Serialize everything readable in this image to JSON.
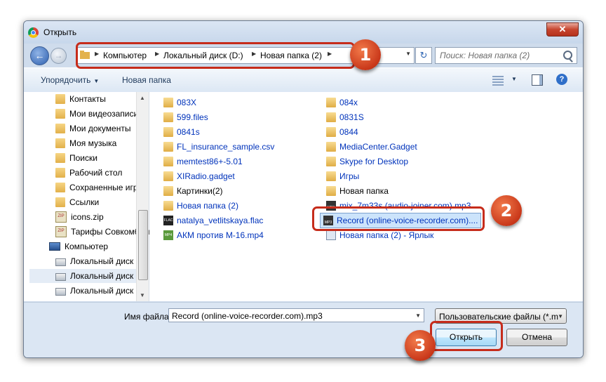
{
  "window": {
    "title": "Открыть",
    "close_label": "✕"
  },
  "navbar": {
    "back_glyph": "←",
    "forward_glyph": "→",
    "breadcrumbs": [
      "Компьютер",
      "Локальный диск (D:)",
      "Новая папка (2)"
    ],
    "refresh_glyph": "↻",
    "search_placeholder": "Поиск: Новая папка (2)"
  },
  "toolbar": {
    "organize_label": "Упорядочить",
    "new_folder_label": "Новая папка",
    "help_label": "?"
  },
  "nav_pane": {
    "items": [
      {
        "label": "Контакты",
        "icon": "folder"
      },
      {
        "label": "Мои видеозаписи",
        "icon": "folder"
      },
      {
        "label": "Мои документы",
        "icon": "folder"
      },
      {
        "label": "Моя музыка",
        "icon": "folder"
      },
      {
        "label": "Поиски",
        "icon": "folder"
      },
      {
        "label": "Рабочий стол",
        "icon": "folder"
      },
      {
        "label": "Сохраненные игры",
        "icon": "folder"
      },
      {
        "label": "Ссылки",
        "icon": "folder"
      },
      {
        "label": "icons.zip",
        "icon": "zip"
      },
      {
        "label": "Тарифы Совкомбанк",
        "icon": "zip"
      },
      {
        "label": "Компьютер",
        "icon": "computer"
      },
      {
        "label": "Локальный диск",
        "icon": "drive"
      },
      {
        "label": "Локальный диск",
        "icon": "drive"
      },
      {
        "label": "Локальный диск",
        "icon": "drive"
      }
    ]
  },
  "files": {
    "left_column": [
      {
        "name": "083X",
        "type": "folder"
      },
      {
        "name": "599.files",
        "type": "folder"
      },
      {
        "name": "0841s",
        "type": "folder"
      },
      {
        "name": "FL_insurance_sample.csv",
        "type": "folder"
      },
      {
        "name": "memtest86+-5.01",
        "type": "folder"
      },
      {
        "name": "XIRadio.gadget",
        "type": "folder"
      },
      {
        "name": "Картинки(2)",
        "type": "folder"
      },
      {
        "name": "Новая папка (2)",
        "type": "folder"
      },
      {
        "name": "natalya_vetlitskaya.flac",
        "type": "flac"
      },
      {
        "name": "АКМ против М-16.mp4",
        "type": "mp4"
      }
    ],
    "right_column": [
      {
        "name": "084x",
        "type": "folder"
      },
      {
        "name": "0831S",
        "type": "folder"
      },
      {
        "name": "0844",
        "type": "folder"
      },
      {
        "name": "MediaCenter.Gadget",
        "type": "folder"
      },
      {
        "name": "Skype for Desktop",
        "type": "folder"
      },
      {
        "name": "Игры",
        "type": "folder"
      },
      {
        "name": "Новая папка",
        "type": "folder"
      },
      {
        "name": "mix_7m33s (audio-joiner.com).mp3",
        "type": "mp3"
      },
      {
        "name": "Record (online-voice-recorder.com)....",
        "type": "mp3",
        "selected": true
      },
      {
        "name": "Новая папка (2) - Ярлык",
        "type": "link"
      }
    ]
  },
  "bottom": {
    "filename_label": "Имя файла:",
    "filename_value": "Record (online-voice-recorder.com).mp3",
    "filetype_value": "Пользовательские файлы (*.m",
    "open_label": "Открыть",
    "cancel_label": "Отмена"
  },
  "callouts": {
    "one": "1",
    "two": "2",
    "three": "3"
  },
  "colors": {
    "callout_red": "#c62c1b",
    "link_blue": "#0033bb",
    "selection": "#cce4fb"
  }
}
